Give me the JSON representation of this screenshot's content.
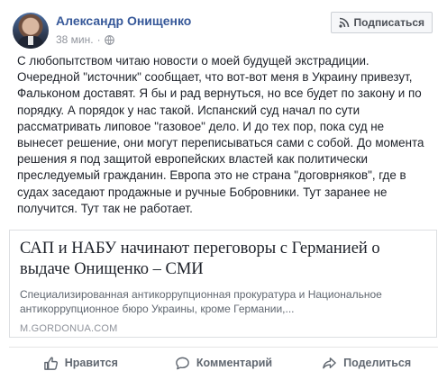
{
  "post": {
    "author": "Александр Онищенко",
    "time": "38 мин.",
    "separator": "·",
    "subscribe_label": "Подписаться",
    "text": "С любопытством читаю новости о моей будущей экстрадиции. Очередной \"источник\" сообщает, что вот-вот меня в Украину привезут, Фальконом доставят. Я бы и рад вернуться, но все будет по закону и по порядку. А порядок у нас такой. Испанский суд начал по сути рассматривать липовое \"газовое\" дело. И до тех пор, пока суд не вынесет решение, они могут переписываться сами с собой. До момента решения я под защитой европейских властей как политически преследуемый гражданин. Европа это не страна \"договрняков\", где в судах заседают продажные и ручные Бобровники. Тут заранее не получится. Тут так не работает."
  },
  "link": {
    "title": "САП и НАБУ начинают переговоры с Германией о выдаче Онищенко – СМИ",
    "description": "Специализированная антикоррупционная прокуратура и Национальное антикоррупционное бюро Украины, кроме Германии,...",
    "domain": "M.GORDONUA.COM"
  },
  "actions": {
    "like": "Нравится",
    "comment": "Комментарий",
    "share": "Поделиться"
  },
  "icons": {
    "globe": "globe-icon",
    "subscribe": "rss-icon",
    "like": "thumbs-up-icon",
    "comment": "comment-icon",
    "share": "share-icon"
  }
}
